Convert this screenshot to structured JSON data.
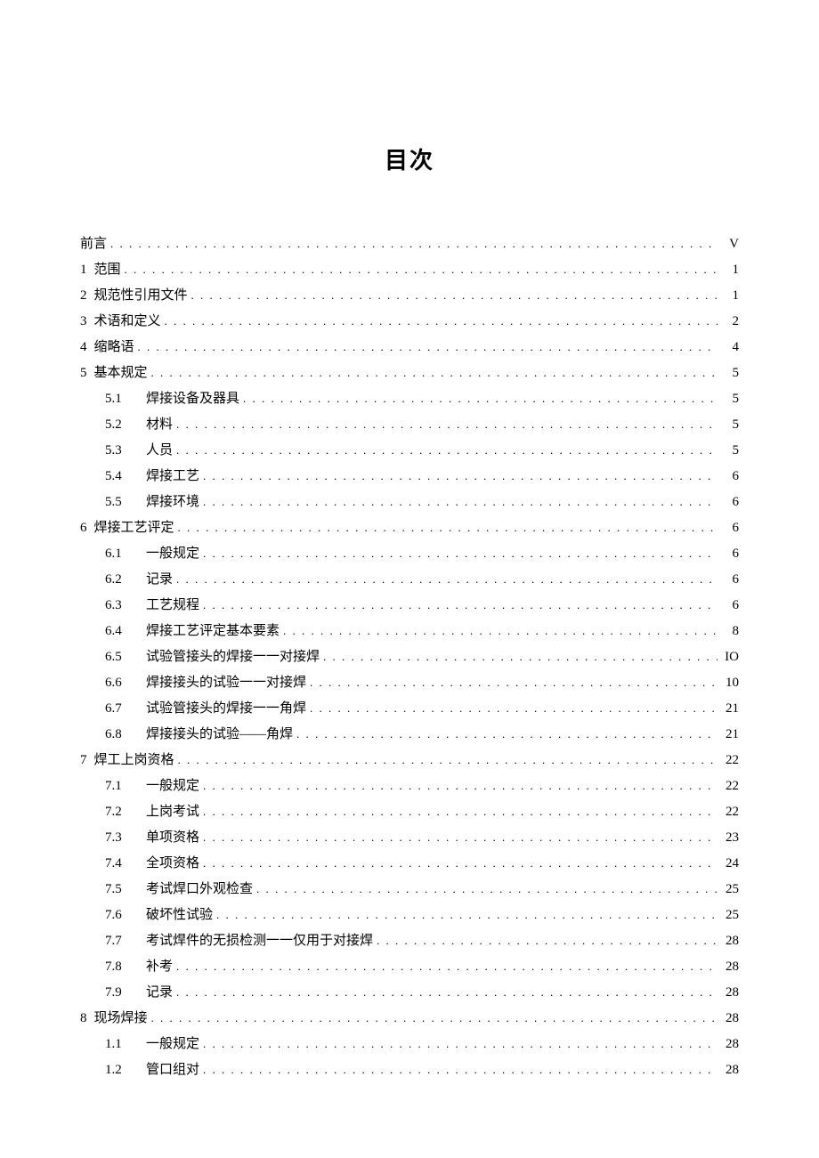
{
  "title": "目次",
  "entries": [
    {
      "level": 1,
      "num": "",
      "label": "前言",
      "page": "V"
    },
    {
      "level": 1,
      "num": "1",
      "label": "范围",
      "page": "1"
    },
    {
      "level": 1,
      "num": "2",
      "label": "规范性引用文件",
      "page": "1"
    },
    {
      "level": 1,
      "num": "3",
      "label": " 术语和定义",
      "page": "2"
    },
    {
      "level": 1,
      "num": "4",
      "label": "缩略语",
      "page": "4"
    },
    {
      "level": 1,
      "num": "5",
      "label": " 基本规定",
      "page": "5"
    },
    {
      "level": 2,
      "num": "5.1",
      "label": "焊接设备及器具",
      "page": "5"
    },
    {
      "level": 2,
      "num": "5.2",
      "label": "材料",
      "page": "5"
    },
    {
      "level": 2,
      "num": "5.3",
      "label": "人员",
      "page": "5"
    },
    {
      "level": 2,
      "num": "5.4",
      "label": "焊接工艺",
      "page": "6"
    },
    {
      "level": 2,
      "num": "5.5",
      "label": "焊接环境",
      "page": "6"
    },
    {
      "level": 1,
      "num": "6",
      "label": "焊接工艺评定",
      "page": "6"
    },
    {
      "level": 2,
      "num": "6.1",
      "label": "一般规定",
      "page": "6"
    },
    {
      "level": 2,
      "num": "6.2",
      "label": "记录",
      "page": "6"
    },
    {
      "level": 2,
      "num": "6.3",
      "label": "工艺规程",
      "page": "6"
    },
    {
      "level": 2,
      "num": "6.4",
      "label": "焊接工艺评定基本要素",
      "page": "8"
    },
    {
      "level": 2,
      "num": "6.5",
      "label": "试验管接头的焊接一一对接焊",
      "page": "IO"
    },
    {
      "level": 2,
      "num": "6.6",
      "label": "焊接接头的试验一一对接焊",
      "page": "10"
    },
    {
      "level": 2,
      "num": "6.7",
      "label": "试验管接头的焊接一一角焊",
      "page": "21"
    },
    {
      "level": 2,
      "num": "6.8",
      "label": "焊接接头的试验——角焊",
      "page": "21"
    },
    {
      "level": 1,
      "num": "7",
      "label": "焊工上岗资格",
      "page": "22"
    },
    {
      "level": 2,
      "num": "7.1",
      "label": "一般规定",
      "page": "22"
    },
    {
      "level": 2,
      "num": "7.2",
      "label": "上岗考试",
      "page": "22"
    },
    {
      "level": 2,
      "num": "7.3",
      "label": "单项资格",
      "page": "23"
    },
    {
      "level": 2,
      "num": "7.4",
      "label": "全项资格",
      "page": "24"
    },
    {
      "level": 2,
      "num": "7.5",
      "label": "考试焊口外观检查",
      "page": "25"
    },
    {
      "level": 2,
      "num": "7.6",
      "label": "破坏性试验",
      "page": "25"
    },
    {
      "level": 2,
      "num": "7.7",
      "label": "考试焊件的无损检测一一仅用于对接焊",
      "page": "28"
    },
    {
      "level": 2,
      "num": "7.8",
      "label": "补考",
      "page": "28"
    },
    {
      "level": 2,
      "num": "7.9",
      "label": "记录",
      "page": "28"
    },
    {
      "level": 1,
      "num": "8",
      "label": "现场焊接",
      "page": "28"
    },
    {
      "level": 2,
      "num": "1.1",
      "label": "一般规定",
      "page": "28"
    },
    {
      "level": 2,
      "num": "1.2",
      "label": "管口组对",
      "page": "28"
    }
  ]
}
